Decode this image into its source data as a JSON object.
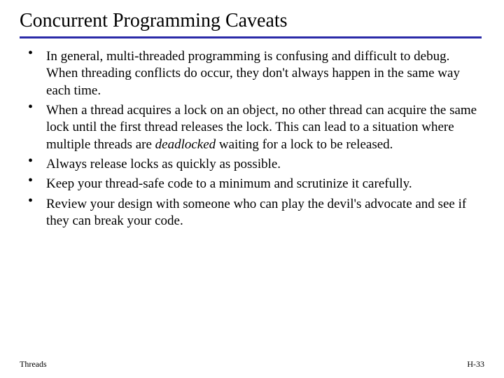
{
  "title": "Concurrent Programming Caveats",
  "bullets": {
    "b1": "In general, multi-threaded programming is confusing and difficult to debug.  When threading conflicts do occur, they don't always happen in the same way each time.",
    "b2a": "When a thread acquires a lock on an object, no other thread can acquire the same lock until the first thread releases the lock. This can lead to a situation where multiple threads are ",
    "b2b": "deadlocked",
    "b2c": " waiting for a lock to be released.",
    "b3": "Always release locks as quickly as possible.",
    "b4": "Keep your thread-safe code to a minimum and scrutinize it carefully.",
    "b5": "Review your design with someone who can play the devil's advocate and see if they can break your code."
  },
  "footer": {
    "left": "Threads",
    "right": "H-33"
  }
}
